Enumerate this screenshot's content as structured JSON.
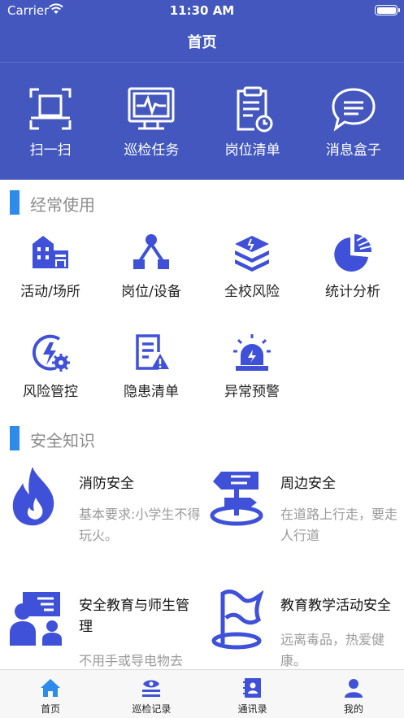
{
  "status_bar": {
    "carrier": "Carrier",
    "time": "11:30 AM"
  },
  "nav": {
    "title": "首页"
  },
  "top_actions": [
    {
      "label": "扫一扫",
      "icon": "scan-icon"
    },
    {
      "label": "巡检任务",
      "icon": "monitor-icon"
    },
    {
      "label": "岗位清单",
      "icon": "clipboard-icon"
    },
    {
      "label": "消息盒子",
      "icon": "message-icon"
    }
  ],
  "frequent": {
    "title": "经常使用",
    "items": [
      {
        "label": "活动/场所",
        "icon": "building-icon"
      },
      {
        "label": "岗位/设备",
        "icon": "network-icon"
      },
      {
        "label": "全校风险",
        "icon": "layers-icon"
      },
      {
        "label": "统计分析",
        "icon": "pie-chart-icon"
      },
      {
        "label": "风险管控",
        "icon": "risk-gear-icon"
      },
      {
        "label": "隐患清单",
        "icon": "hazard-list-icon"
      },
      {
        "label": "异常预警",
        "icon": "alarm-icon"
      }
    ]
  },
  "knowledge": {
    "title": "安全知识",
    "items": [
      {
        "title": "消防安全",
        "desc": "基本要求:小学生不得玩火。",
        "icon": "fire-icon"
      },
      {
        "title": "周边安全",
        "desc": "在道路上行走，要走人行道",
        "icon": "signpost-icon"
      },
      {
        "title": "安全教育与师生管理",
        "desc": "不用手或导电物去",
        "icon": "teacher-icon"
      },
      {
        "title": "教育教学活动安全",
        "desc": "远离毒品，热爱健康。",
        "icon": "flag-icon"
      }
    ]
  },
  "tabbar": [
    {
      "label": "首页",
      "icon": "home-icon",
      "active": true
    },
    {
      "label": "巡检记录",
      "icon": "inspection-record-icon"
    },
    {
      "label": "通讯录",
      "icon": "contacts-icon"
    },
    {
      "label": "我的",
      "icon": "person-icon"
    }
  ],
  "colors": {
    "primary": "#4357BE",
    "accent_bar": "#2E8BEA",
    "icon_blue": "#3F51D8",
    "tab_active": "#2E8BEA"
  }
}
